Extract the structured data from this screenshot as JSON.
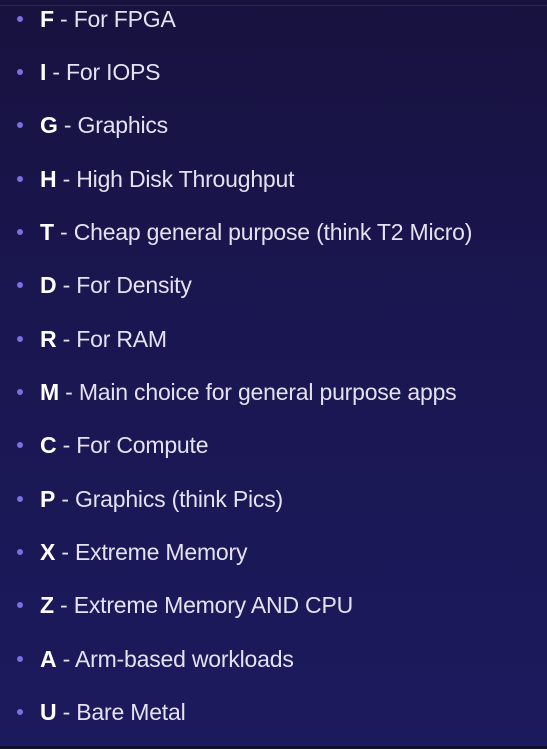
{
  "items": [
    {
      "letter": "F",
      "sep": " - ",
      "desc": "For FPGA"
    },
    {
      "letter": "I",
      "sep": " - ",
      "desc": "For IOPS"
    },
    {
      "letter": "G",
      "sep": " - ",
      "desc": "Graphics"
    },
    {
      "letter": "H",
      "sep": " - ",
      "desc": "High Disk Throughput"
    },
    {
      "letter": "T",
      "sep": " - ",
      "desc": "Cheap general purpose (think T2 Micro)"
    },
    {
      "letter": "D",
      "sep": " - ",
      "desc": "For Density"
    },
    {
      "letter": "R",
      "sep": " - ",
      "desc": "For RAM"
    },
    {
      "letter": "M",
      "sep": " - ",
      "desc": "Main choice for general purpose apps"
    },
    {
      "letter": "C",
      "sep": " - ",
      "desc": "For Compute"
    },
    {
      "letter": "P",
      "sep": " - ",
      "desc": "Graphics (think Pics)"
    },
    {
      "letter": "X",
      "sep": " - ",
      "desc": "Extreme Memory"
    },
    {
      "letter": "Z",
      "sep": " - ",
      "desc": "Extreme Memory AND CPU"
    },
    {
      "letter": "A",
      "sep": " - ",
      "desc": "Arm-based workloads"
    },
    {
      "letter": "U",
      "sep": " - ",
      "desc": "Bare Metal"
    }
  ],
  "colors": {
    "background": "#1a1650",
    "bullet": "#7d6fe0",
    "letter": "#ffffff",
    "text": "#e4e2f0"
  }
}
